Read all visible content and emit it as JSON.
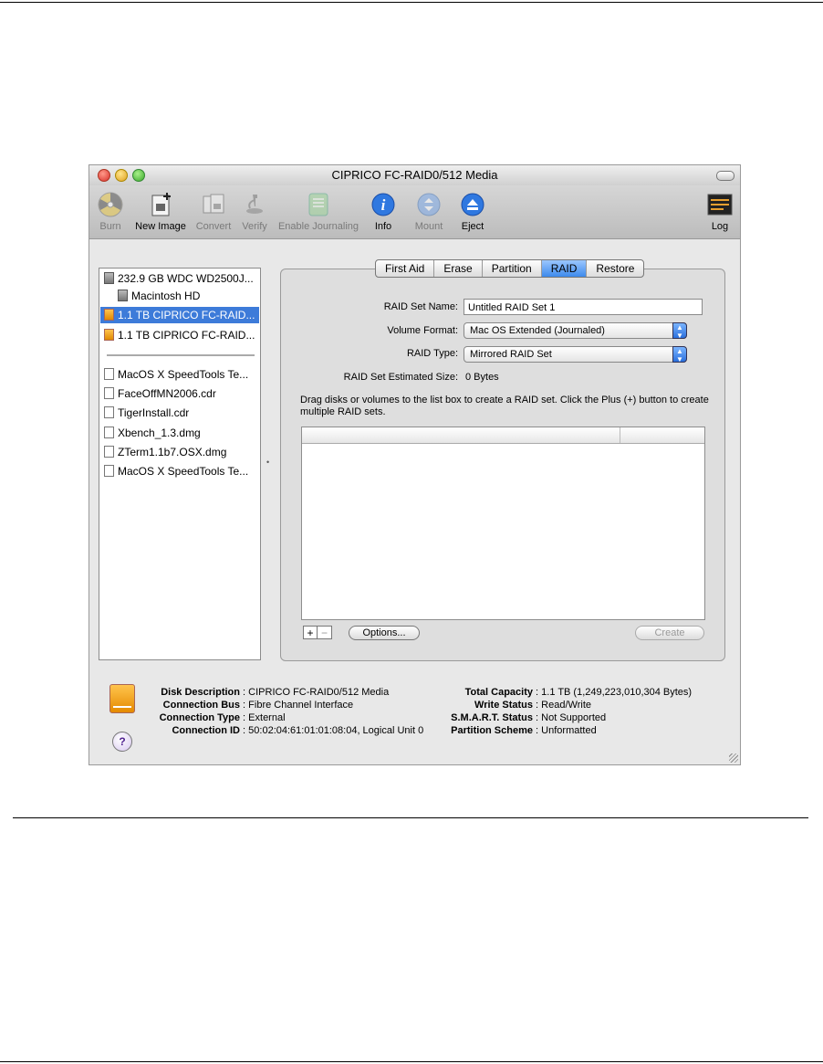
{
  "window": {
    "title": "CIPRICO FC-RAID0/512 Media"
  },
  "toolbar": {
    "items": [
      {
        "label": "Burn",
        "icon": "burn-icon",
        "enabled": false
      },
      {
        "label": "New Image",
        "icon": "new-image-icon",
        "enabled": true
      },
      {
        "label": "Convert",
        "icon": "convert-icon",
        "enabled": false
      },
      {
        "label": "Verify",
        "icon": "verify-icon",
        "enabled": false
      },
      {
        "label": "Enable Journaling",
        "icon": "journaling-icon",
        "enabled": false
      },
      {
        "label": "Info",
        "icon": "info-icon",
        "enabled": true
      },
      {
        "label": "Mount",
        "icon": "mount-icon",
        "enabled": false
      },
      {
        "label": "Eject",
        "icon": "eject-icon",
        "enabled": true
      },
      {
        "label": "Log",
        "icon": "log-icon",
        "enabled": true
      }
    ]
  },
  "sidebar": {
    "items": [
      {
        "label": "232.9 GB WDC WD2500J...",
        "icon": "hard-disk-icon"
      },
      {
        "label": "Macintosh HD",
        "icon": "volume-icon"
      },
      {
        "label": "1.1 TB CIPRICO FC-RAID...",
        "icon": "raid-disk-icon",
        "selected": true
      },
      {
        "label": "1.1 TB CIPRICO FC-RAID...",
        "icon": "raid-disk-icon"
      },
      {
        "label": "MacOS X SpeedTools Te...",
        "icon": "disk-image-icon"
      },
      {
        "label": "FaceOffMN2006.cdr",
        "icon": "disk-image-icon"
      },
      {
        "label": "TigerInstall.cdr",
        "icon": "disk-image-icon"
      },
      {
        "label": "Xbench_1.3.dmg",
        "icon": "disk-image-icon"
      },
      {
        "label": "ZTerm1.1b7.OSX.dmg",
        "icon": "disk-image-icon"
      },
      {
        "label": "MacOS X SpeedTools Te...",
        "icon": "disk-image-icon"
      }
    ]
  },
  "tabs": [
    "First Aid",
    "Erase",
    "Partition",
    "RAID",
    "Restore"
  ],
  "active_tab": "RAID",
  "raid": {
    "set_name_label": "RAID Set Name:",
    "set_name_value": "Untitled RAID Set 1",
    "volume_format_label": "Volume Format:",
    "volume_format_value": "Mac OS Extended (Journaled)",
    "raid_type_label": "RAID Type:",
    "raid_type_value": "Mirrored RAID Set",
    "estimated_size_label": "RAID Set Estimated Size:",
    "estimated_size_value": "0 Bytes",
    "instructions": "Drag disks or volumes to the list box to create a RAID set. Click the Plus (+) button to create multiple RAID sets.",
    "plus_label": "+",
    "minus_label": "−",
    "options_label": "Options...",
    "create_label": "Create"
  },
  "disk_info": {
    "left": [
      {
        "key": "Disk Description",
        "value": "CIPRICO FC-RAID0/512 Media"
      },
      {
        "key": "Connection Bus",
        "value": "Fibre Channel Interface"
      },
      {
        "key": "Connection Type",
        "value": "External"
      },
      {
        "key": "Connection ID",
        "value": "50:02:04:61:01:01:08:04, Logical Unit 0"
      }
    ],
    "right": [
      {
        "key": "Total Capacity",
        "value": "1.1 TB (1,249,223,010,304 Bytes)"
      },
      {
        "key": "Write Status",
        "value": "Read/Write"
      },
      {
        "key": "S.M.A.R.T. Status",
        "value": "Not Supported"
      },
      {
        "key": "Partition Scheme",
        "value": "Unformatted"
      }
    ],
    "separator": " : ",
    "help_label": "?"
  },
  "colors": {
    "selection": "#3d7bd9",
    "raid_disk": "#f0a020",
    "active_tab": "#3d8aec"
  }
}
